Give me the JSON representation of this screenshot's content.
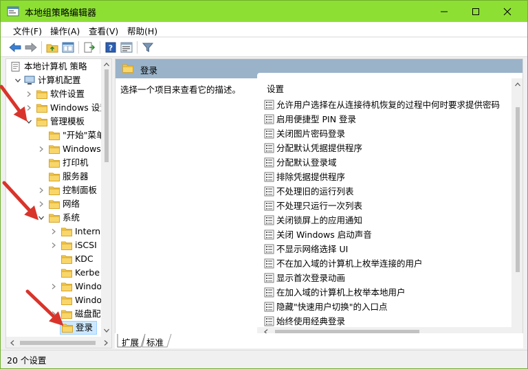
{
  "window": {
    "title": "本地组策略编辑器"
  },
  "menu": {
    "file": "文件(F)",
    "action": "操作(A)",
    "view": "查看(V)",
    "help": "帮助(H)"
  },
  "tree": {
    "root": "本地计算机 策略",
    "computer_config": "计算机配置",
    "software_settings": "软件设置",
    "windows_settings": "Windows 设置",
    "admin_templates": "管理模板",
    "start_menu": "\"开始\"菜单",
    "windows_components": "Windows",
    "printers": "打印机",
    "server": "服务器",
    "control_panel": "控制面板",
    "network": "网络",
    "system": "系统",
    "internet": "Intern",
    "iscsi": "iSCSI",
    "kdc": "KDC",
    "kerberos": "Kerbe",
    "windo1": "Windo",
    "windo2": "Windo",
    "disk": "磁盘配",
    "logon": "登录"
  },
  "panel": {
    "title": "登录",
    "description": "选择一个项目来查看它的描述。",
    "column_header": "设置",
    "items": [
      "允许用户选择在从连接待机恢复的过程中何时要求提供密码",
      "启用便捷型 PIN 登录",
      "关闭图片密码登录",
      "分配默认凭据提供程序",
      "分配默认登录域",
      "排除凭据提供程序",
      "不处理旧的运行列表",
      "不处理只运行一次列表",
      "关闭锁屏上的应用通知",
      "关闭 Windows 启动声音",
      "不显示网络选择 UI",
      "不在加入域的计算机上枚举连接的用户",
      "显示首次登录动画",
      "在加入域的计算机上枚举本地用户",
      "隐藏\"快速用户切换\"的入口点",
      "始终使用经典登录"
    ]
  },
  "tabs": {
    "extended": "扩展",
    "standard": "标准"
  },
  "status": {
    "text": "20 个设置"
  },
  "colors": {
    "titlebar": "#8de033",
    "panel_header": "#9ab3c9",
    "folder": "#f3c94f",
    "arrow": "#d9342b"
  }
}
